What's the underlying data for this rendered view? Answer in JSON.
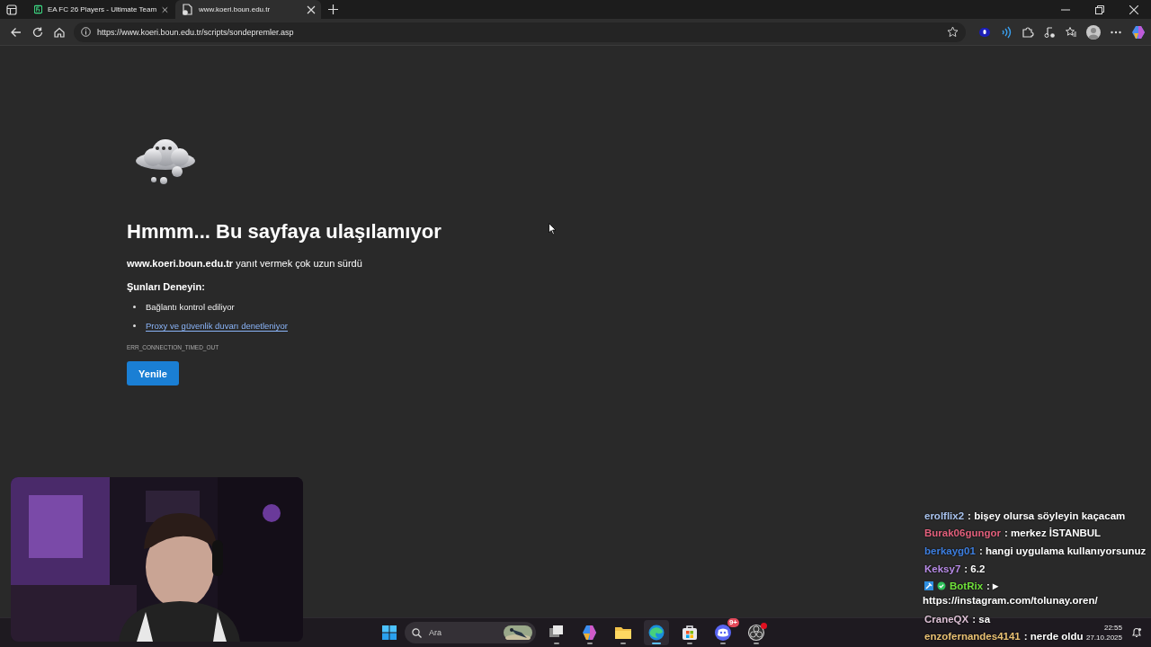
{
  "tabs": [
    {
      "title": "EA FC 26 Players - Ultimate Team",
      "kind": "site",
      "selected": false
    },
    {
      "title": "www.koeri.boun.edu.tr",
      "kind": "error",
      "selected": true
    }
  ],
  "address_bar": {
    "url": "https://www.koeri.boun.edu.tr/scripts/sondepremler.asp"
  },
  "error_page": {
    "heading": "Hmmm... Bu sayfaya ulaşılamıyor",
    "message": "**www.koeri.boun.edu.tr** yanıt vermek çok uzun sürdü",
    "try_title": "Şunları Deneyin:",
    "suggestions": [
      {
        "kind": "text",
        "text": "Bağlantı kontrol ediliyor"
      },
      {
        "kind": "link",
        "text": "Proxy ve güvenlik duvarı denetleniyor"
      }
    ],
    "error_code": "ERR_CONNECTION_TIMED_OUT",
    "button": "Yenile"
  },
  "chat": {
    "messages": [
      {
        "user": "erolflix2",
        "color": "#a9c3ee",
        "text": ": bişey olursa söyleyin kaçacam"
      },
      {
        "user": "Burak06gungor",
        "color": "#e2607c",
        "text": ": merkez İSTANBUL"
      },
      {
        "user": "berkayg01",
        "color": "#3e7fe0",
        "text": ": hangi uygulama kullanıyorsunuz"
      },
      {
        "user": "Keksy7",
        "color": "#b98ce8",
        "text": ": 6.2"
      },
      {
        "user": "BotRix",
        "color": "#6fe03b",
        "badges": [
          {
            "kind": "moderator"
          },
          {
            "kind": "verified"
          }
        ],
        "text": ": ▸",
        "link": "https://instagram.com/tolunay.oren/"
      },
      {
        "user": "CraneQX",
        "color": "#dcc0d4",
        "text": ": sa"
      },
      {
        "user": "enzofernandes4141",
        "color": "#e9c173",
        "text": ": nerde oldu"
      }
    ]
  },
  "taskbar": {
    "search_placeholder": "Ara",
    "apps": [
      {
        "kind": "task-view",
        "selected": false
      },
      {
        "kind": "copilot",
        "selected": false
      },
      {
        "kind": "folder",
        "selected": false
      },
      {
        "kind": "edge",
        "selected": true
      },
      {
        "kind": "store",
        "selected": false
      },
      {
        "kind": "discord",
        "selected": false,
        "badge": "9+"
      },
      {
        "kind": "obs",
        "selected": false,
        "notification": true
      }
    ],
    "time": "22:55",
    "date": "27.10.2025"
  }
}
